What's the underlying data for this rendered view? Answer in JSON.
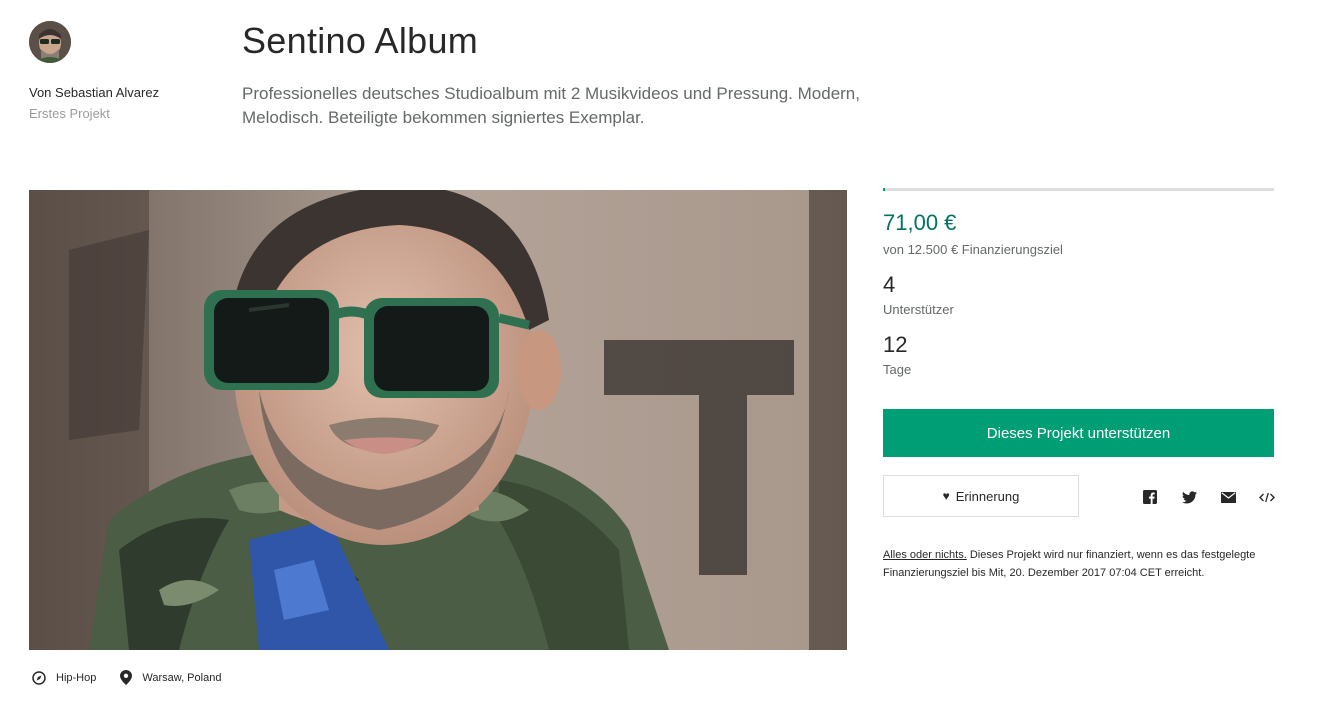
{
  "creator": {
    "name": "Von Sebastian Alvarez",
    "subtitle": "Erstes Projekt"
  },
  "project": {
    "title": "Sentino Album",
    "blurb": "Professionelles deutsches Studioalbum mit 2 Musikvideos und Pressung. Modern, Melodisch. Beteiligte bekommen signiertes Exemplar."
  },
  "stats": {
    "progress_fraction": 0.0057,
    "pledged": "71,00 €",
    "goal": "von 12.500 € Finanzierungsziel",
    "backers_count": "4",
    "backers_label": "Unterstützer",
    "days_count": "12",
    "days_label": "Tage"
  },
  "actions": {
    "back_label": "Dieses Projekt unterstützen",
    "remind_label": "Erinnerung",
    "share_icons": [
      "facebook-icon",
      "twitter-icon",
      "email-icon",
      "embed-icon"
    ]
  },
  "fineprint": {
    "link": "Alles oder nichts.",
    "text": " Dieses Projekt wird nur finanziert, wenn es das festgelegte Finanzierungsziel bis Mit, 20. Dezember 2017 07:04 CET erreicht."
  },
  "meta": {
    "category": "Hip-Hop",
    "location": "Warsaw, Poland"
  },
  "colors": {
    "accent": "#009e74",
    "pledged_text": "#037362"
  }
}
